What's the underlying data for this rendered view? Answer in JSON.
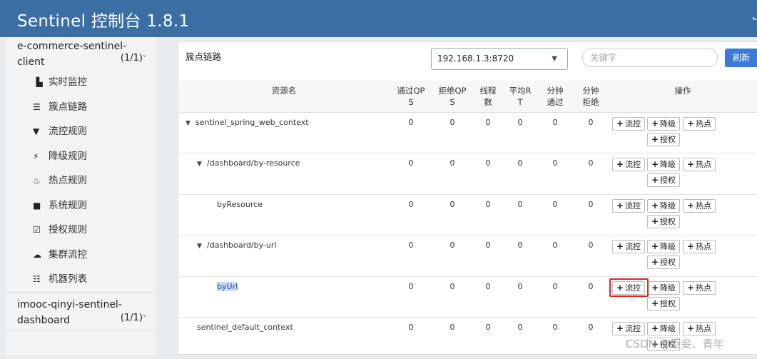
{
  "header": {
    "title": "Sentinel 控制台 1.8.1"
  },
  "sidebar": {
    "apps": [
      {
        "name_line1": "e-commerce-sentinel-",
        "name_line2": "client",
        "count": "(1/1)"
      },
      {
        "name_line1": "imooc-qinyi-sentinel-",
        "name_line2": "dashboard",
        "count": "(1/1)"
      }
    ],
    "menu": [
      {
        "label": "实时监控",
        "icon": "bar-chart-icon"
      },
      {
        "label": "簇点链路",
        "icon": "list-icon"
      },
      {
        "label": "流控规则",
        "icon": "filter-icon"
      },
      {
        "label": "降级规则",
        "icon": "flash-icon"
      },
      {
        "label": "热点规则",
        "icon": "fire-icon"
      },
      {
        "label": "系统规则",
        "icon": "briefcase-icon"
      },
      {
        "label": "授权规则",
        "icon": "check-square-icon"
      },
      {
        "label": "集群流控",
        "icon": "cloud-icon"
      },
      {
        "label": "机器列表",
        "icon": "th-list-icon"
      }
    ]
  },
  "main": {
    "title": "簇点链路",
    "machine_select": "192.168.1.3:8720",
    "search_placeholder": "关键字",
    "refresh_label": "刷新"
  },
  "table": {
    "headers": {
      "resource": "资源名",
      "pass_qps_1": "通过QP",
      "pass_qps_2": "S",
      "block_qps_1": "拒绝QP",
      "block_qps_2": "S",
      "threads_1": "线程",
      "threads_2": "数",
      "avg_rt_1": "平均R",
      "avg_rt_2": "T",
      "minute_pass_1": "分钟",
      "minute_pass_2": "通过",
      "minute_block_1": "分钟",
      "minute_block_2": "拒绝",
      "actions": "操作"
    },
    "rows": [
      {
        "name": "sentinel_spring_web_context",
        "pass_qps": "0",
        "block_qps": "0",
        "threads": "0",
        "avg_rt": "0",
        "minute_pass": "0",
        "minute_block": "0"
      },
      {
        "name": "/dashboard/by-resource",
        "pass_qps": "0",
        "block_qps": "0",
        "threads": "0",
        "avg_rt": "0",
        "minute_pass": "0",
        "minute_block": "0"
      },
      {
        "name": "byResource",
        "pass_qps": "0",
        "block_qps": "0",
        "threads": "0",
        "avg_rt": "0",
        "minute_pass": "0",
        "minute_block": "0"
      },
      {
        "name": "/dashboard/by-url",
        "pass_qps": "0",
        "block_qps": "0",
        "threads": "0",
        "avg_rt": "0",
        "minute_pass": "0",
        "minute_block": "0"
      },
      {
        "name": "byUrl",
        "pass_qps": "0",
        "block_qps": "0",
        "threads": "0",
        "avg_rt": "0",
        "minute_pass": "0",
        "minute_block": "0"
      },
      {
        "name": "sentinel_default_context",
        "pass_qps": "0",
        "block_qps": "0",
        "threads": "0",
        "avg_rt": "0",
        "minute_pass": "0",
        "minute_block": "0"
      }
    ],
    "actions": {
      "flow": "流控",
      "degrade": "降级",
      "hot": "热点",
      "auth": "授权"
    }
  },
  "watermark": "CSDN @臣妾、青年",
  "colors": {
    "header": "#3a6ea5",
    "refresh": "#3a7bd5",
    "highlight_box": "#e52222"
  }
}
